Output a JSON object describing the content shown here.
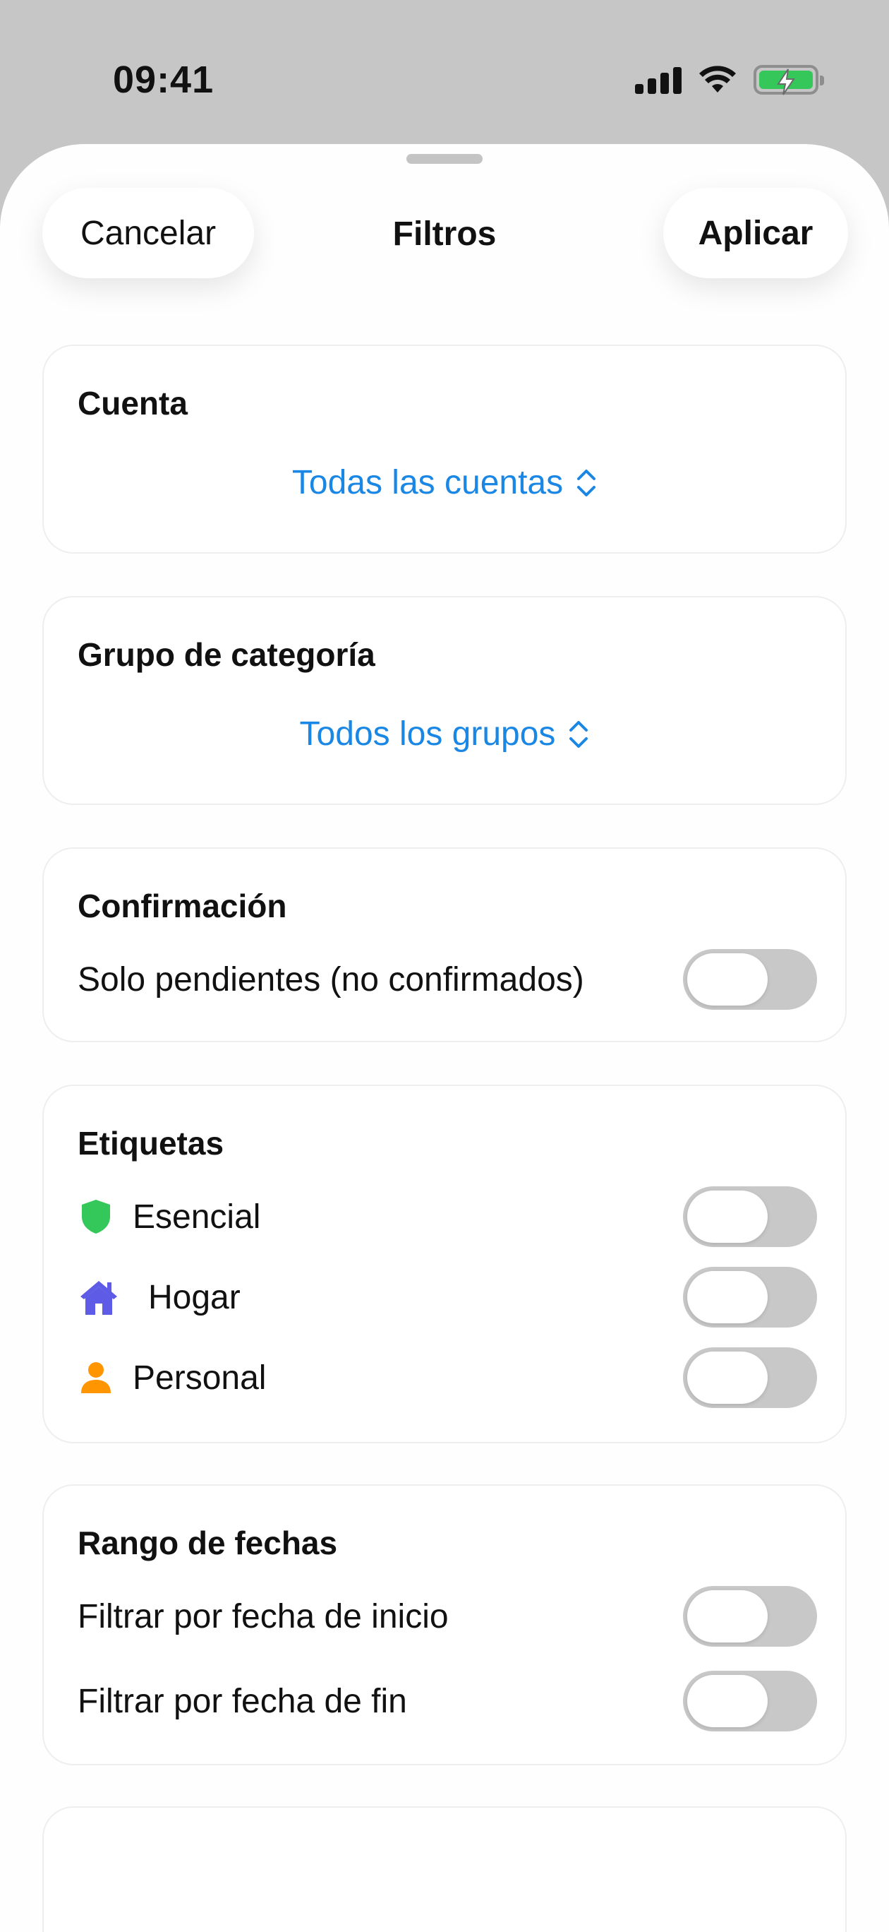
{
  "status_bar": {
    "time": "09:41"
  },
  "header": {
    "cancel_label": "Cancelar",
    "title": "Filtros",
    "apply_label": "Aplicar"
  },
  "account": {
    "title": "Cuenta",
    "value": "Todas las cuentas"
  },
  "category_group": {
    "title": "Grupo de categoría",
    "value": "Todos los grupos"
  },
  "confirmation": {
    "title": "Confirmación",
    "pending_label": "Solo pendientes (no confirmados)",
    "pending_on": false
  },
  "tags": {
    "title": "Etiquetas",
    "items": [
      {
        "label": "Esencial",
        "icon": "shield-icon",
        "color": "#34c759",
        "on": false
      },
      {
        "label": "Hogar",
        "icon": "house-icon",
        "color": "#5e5ce6",
        "on": false
      },
      {
        "label": "Personal",
        "icon": "person-icon",
        "color": "#ff9500",
        "on": false
      }
    ]
  },
  "date_range": {
    "title": "Rango de fechas",
    "start_label": "Filtrar por fecha de inicio",
    "end_label": "Filtrar por fecha de fin",
    "start_on": false,
    "end_on": false
  },
  "colors": {
    "accent": "#1a87e5",
    "toggle_off": "#c8c8c8"
  }
}
